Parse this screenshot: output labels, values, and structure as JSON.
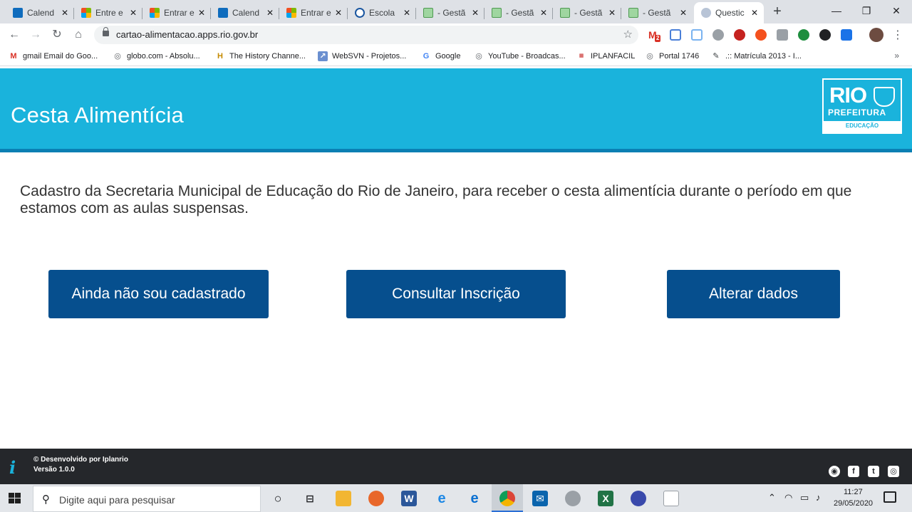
{
  "browser": {
    "tabs": [
      {
        "title": "Calend",
        "icon": "calendar-icon"
      },
      {
        "title": "Entre e",
        "icon": "microsoft-icon"
      },
      {
        "title": "Entrar e",
        "icon": "microsoft-icon"
      },
      {
        "title": "Calend",
        "icon": "calendar-icon"
      },
      {
        "title": "Entrar e",
        "icon": "microsoft-icon"
      },
      {
        "title": "Escola",
        "icon": "school-icon"
      },
      {
        "title": "- Gestã",
        "icon": "sheet-icon"
      },
      {
        "title": "- Gestã",
        "icon": "sheet-icon"
      },
      {
        "title": "- Gestã",
        "icon": "sheet-icon"
      },
      {
        "title": "- Gestã",
        "icon": "sheet-icon"
      },
      {
        "title": "Questic",
        "icon": "form-icon",
        "active": true
      }
    ],
    "new_tab_label": "+",
    "url": "cartao-alimentacao.apps.rio.gov.br",
    "extension_badge": "2",
    "bookmarks": [
      {
        "label": "gmail Email do Goo...",
        "icon": "gmail-icon"
      },
      {
        "label": "globo.com - Absolu...",
        "icon": "globe-icon"
      },
      {
        "label": "The History Channe...",
        "icon": "history-icon"
      },
      {
        "label": "WebSVN - Projetos...",
        "icon": "websvn-icon"
      },
      {
        "label": "Google",
        "icon": "google-icon"
      },
      {
        "label": "YouTube - Broadcas...",
        "icon": "globe-icon"
      },
      {
        "label": "IPLANFACIL",
        "icon": "iplan-icon"
      },
      {
        "label": "Portal 1746",
        "icon": "globe-icon"
      },
      {
        "label": ".:: Matrícula 2013 - I...",
        "icon": "pencil-icon"
      }
    ],
    "bookmarks_more": "»"
  },
  "page": {
    "title": "Cesta Alimentícia",
    "logo": {
      "line1": "RIO",
      "line2": "PREFEITURA",
      "line3": "EDUCAÇÃO"
    },
    "intro": "Cadastro da Secretaria Municipal de Educação do Rio de Janeiro, para receber o cesta alimentícia durante o período em que estamos com as aulas suspensas.",
    "buttons": {
      "register": "Ainda não sou cadastrado",
      "check": "Consultar Inscrição",
      "edit": "Alterar dados"
    },
    "footer": {
      "developer": "© Desenvolvido por Iplanrio",
      "version": "Versão 1.0.0",
      "social": [
        "website-icon",
        "facebook-icon",
        "twitter-icon",
        "instagram-icon"
      ]
    },
    "colors": {
      "header": "#1ab3dc",
      "button": "#064f8e",
      "footer": "#25272b"
    }
  },
  "taskbar": {
    "search_placeholder": "Digite aqui para pesquisar",
    "time": "11:27",
    "date": "29/05/2020"
  }
}
